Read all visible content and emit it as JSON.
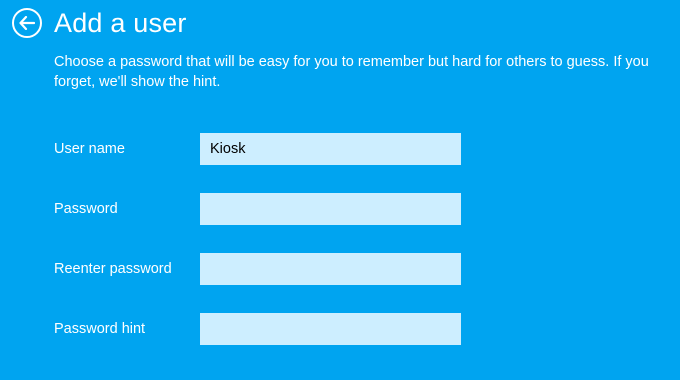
{
  "header": {
    "title": "Add a user",
    "back_icon": "back-arrow-icon"
  },
  "description": "Choose a password that will be easy for you to remember but hard for others to guess. If you forget, we'll show the hint.",
  "form": {
    "username": {
      "label": "User name",
      "value": "Kiosk"
    },
    "password": {
      "label": "Password",
      "value": ""
    },
    "reenter_password": {
      "label": "Reenter password",
      "value": ""
    },
    "password_hint": {
      "label": "Password hint",
      "value": ""
    }
  },
  "colors": {
    "background": "#00a4f0",
    "input_background": "#cdeeff",
    "text": "#ffffff"
  }
}
